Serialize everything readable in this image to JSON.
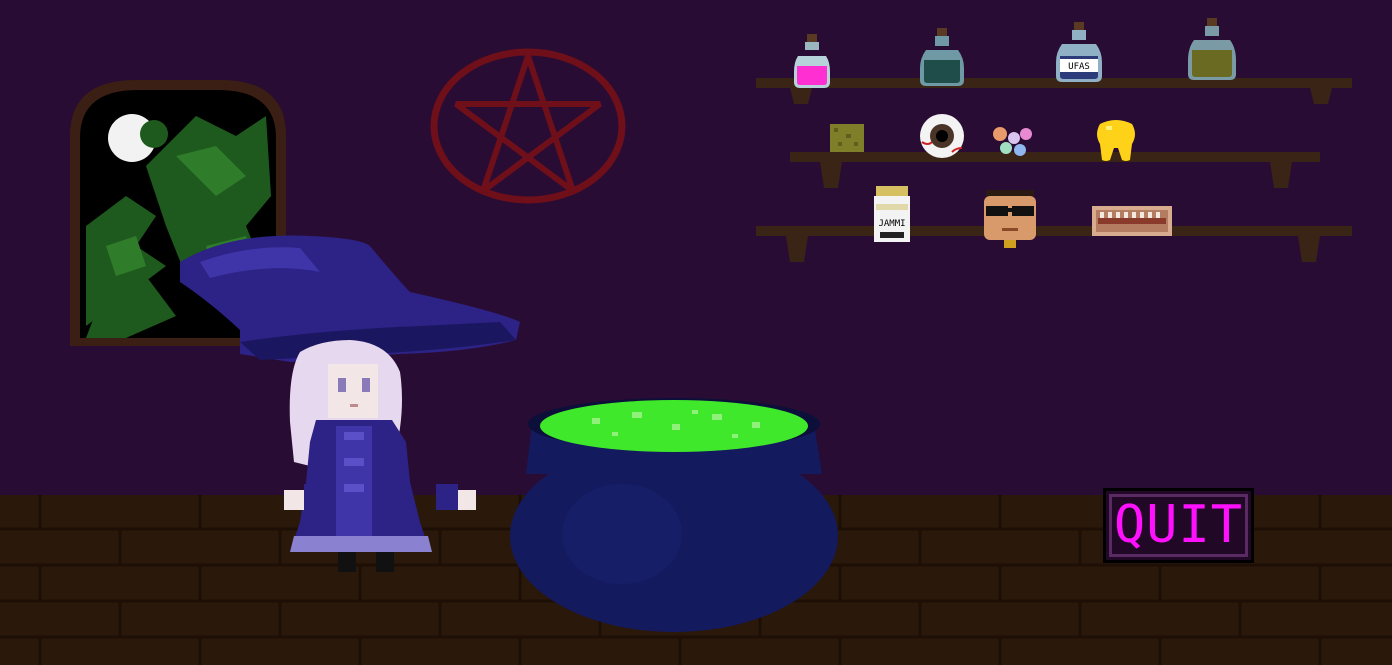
{
  "ui": {
    "quit_label": "QUIT"
  },
  "shelf_items": {
    "jar_label": "UFAS",
    "jammi_label": "JAMMI"
  },
  "colors": {
    "wall": "#290c33",
    "floor": "#2a180b",
    "shelf": "#3a2416",
    "pentagram": "#6e0f19",
    "cauldron": "#131a5e",
    "brew": "#3fe82a",
    "quit_text": "#ff10ff",
    "witch_hat": "#2d2285",
    "witch_hair": "#e6d8ee"
  }
}
